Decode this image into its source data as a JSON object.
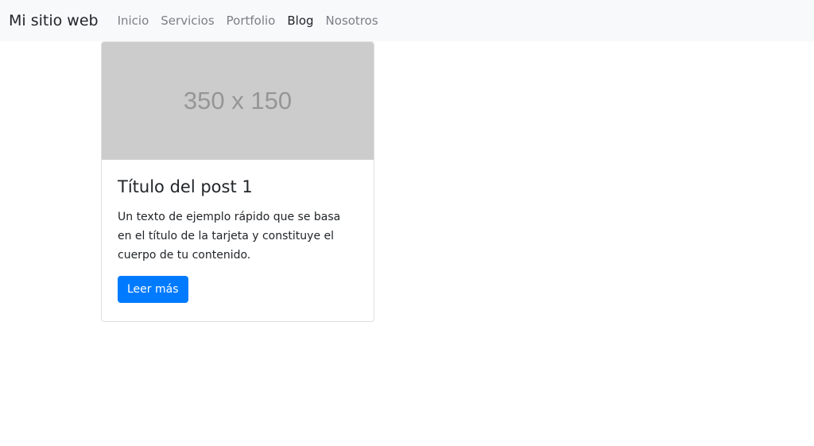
{
  "navbar": {
    "brand": "Mi sitio web",
    "links": [
      {
        "label": "Inicio",
        "active": false
      },
      {
        "label": "Servicios",
        "active": false
      },
      {
        "label": "Portfolio",
        "active": false
      },
      {
        "label": "Blog",
        "active": true
      },
      {
        "label": "Nosotros",
        "active": false
      }
    ]
  },
  "post": {
    "image_placeholder": "350 x 150",
    "title": "Título del post 1",
    "text": "Un texto de ejemplo rápido que se basa en el título de la tarjeta y constituye el cuerpo de tu contenido.",
    "button_label": "Leer más"
  },
  "colors": {
    "primary": "#007bff",
    "navbar_bg": "#f8f9fa",
    "placeholder_bg": "#cccccc"
  }
}
